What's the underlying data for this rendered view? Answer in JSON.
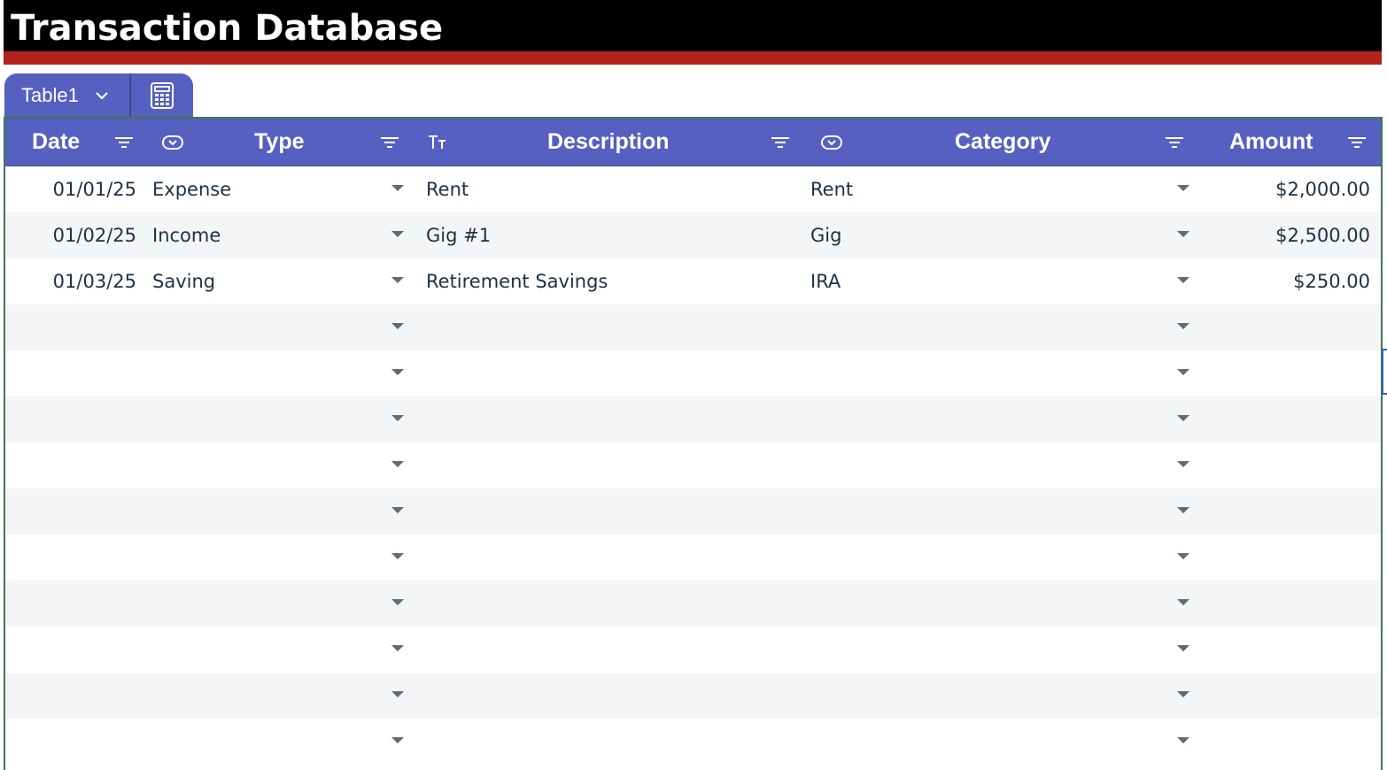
{
  "sheet": {
    "title": "Transaction Database"
  },
  "table": {
    "name": "Table1",
    "columns": [
      {
        "key": "date",
        "label": "Date",
        "type_icon": "none",
        "filter_icon": "filter-icon"
      },
      {
        "key": "type",
        "label": "Type",
        "type_icon": "dropdown-chip-icon",
        "filter_icon": "filter-icon"
      },
      {
        "key": "description",
        "label": "Description",
        "type_icon": "text-type-icon",
        "filter_icon": "filter-icon"
      },
      {
        "key": "category",
        "label": "Category",
        "type_icon": "dropdown-chip-icon",
        "filter_icon": "filter-icon"
      },
      {
        "key": "amount",
        "label": "Amount",
        "type_icon": "none",
        "filter_icon": "filter-icon"
      }
    ],
    "rows": [
      {
        "date": "01/01/25",
        "type": "Expense",
        "description": "Rent",
        "category": "Rent",
        "amount": "$2,000.00"
      },
      {
        "date": "01/02/25",
        "type": "Income",
        "description": "Gig #1",
        "category": "Gig",
        "amount": "$2,500.00"
      },
      {
        "date": "01/03/25",
        "type": "Saving",
        "description": "Retirement Savings",
        "category": "IRA",
        "amount": "$250.00"
      },
      {
        "date": "",
        "type": "",
        "description": "",
        "category": "",
        "amount": ""
      },
      {
        "date": "",
        "type": "",
        "description": "",
        "category": "",
        "amount": ""
      },
      {
        "date": "",
        "type": "",
        "description": "",
        "category": "",
        "amount": ""
      },
      {
        "date": "",
        "type": "",
        "description": "",
        "category": "",
        "amount": ""
      },
      {
        "date": "",
        "type": "",
        "description": "",
        "category": "",
        "amount": ""
      },
      {
        "date": "",
        "type": "",
        "description": "",
        "category": "",
        "amount": ""
      },
      {
        "date": "",
        "type": "",
        "description": "",
        "category": "",
        "amount": ""
      },
      {
        "date": "",
        "type": "",
        "description": "",
        "category": "",
        "amount": ""
      },
      {
        "date": "",
        "type": "",
        "description": "",
        "category": "",
        "amount": ""
      },
      {
        "date": "",
        "type": "",
        "description": "",
        "category": "",
        "amount": ""
      }
    ]
  },
  "icons": {
    "tab_dropdown": "chevron-down-icon",
    "tab_calculator": "calculator-icon",
    "cell_dropdown": "dropdown-arrow-icon"
  },
  "colors": {
    "title_background": "#000000",
    "title_underline": "#b3231b",
    "header_background": "#5660c0",
    "table_border": "#3b7a50",
    "alt_row": "#f3f5f7",
    "cell_text": "#1d3144"
  }
}
